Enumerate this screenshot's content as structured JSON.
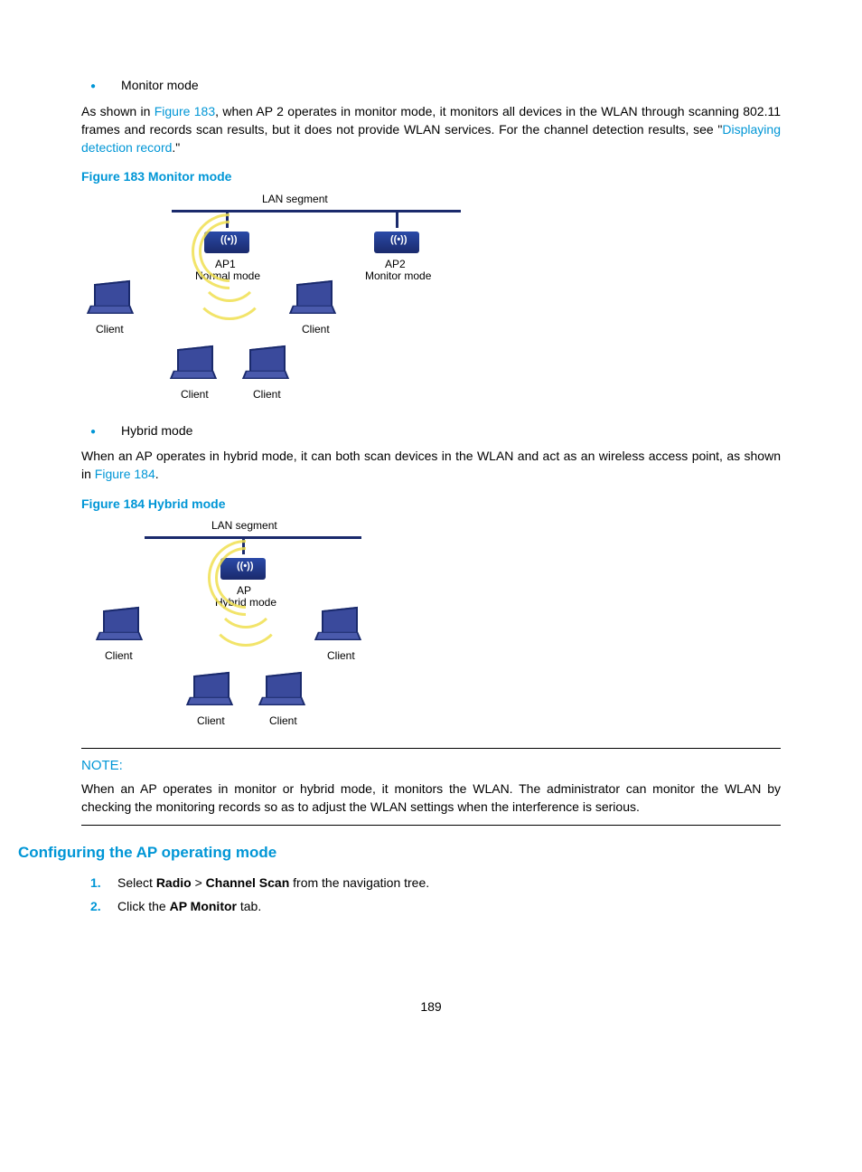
{
  "bullets": {
    "monitor": "Monitor mode",
    "hybrid": "Hybrid mode"
  },
  "para1_pre": "As shown in ",
  "para1_link": "Figure 183",
  "para1_post": ", when AP 2 operates in monitor mode, it monitors all devices in the WLAN through scanning 802.11 frames and records scan results, but it does not provide WLAN services. For the channel detection results, see \"",
  "para1_link2": "Displaying detection record",
  "para1_end": ".\"",
  "fig183_caption": "Figure 183 Monitor mode",
  "fig183": {
    "lan": "LAN segment",
    "ap1": "AP1",
    "ap1_mode": "Normal mode",
    "ap2": "AP2",
    "ap2_mode": "Monitor mode",
    "client": "Client"
  },
  "para2_pre": "When an AP operates in hybrid mode, it can both scan devices in the WLAN and act as an wireless access point, as shown in ",
  "para2_link": "Figure 184",
  "para2_end": ".",
  "fig184_caption": "Figure 184 Hybrid mode",
  "fig184": {
    "lan": "LAN segment",
    "ap": "AP",
    "ap_mode": "Hybrid mode",
    "client": "Client"
  },
  "note_label": "NOTE:",
  "note_body": "When an AP operates in monitor or hybrid mode, it monitors the WLAN. The administrator can monitor the WLAN by checking the monitoring records so as to adjust the WLAN settings when the interference is serious.",
  "heading": "Configuring the AP operating mode",
  "steps": {
    "s1": {
      "num": "1.",
      "pre": "Select ",
      "b1": "Radio",
      "mid": " > ",
      "b2": "Channel Scan",
      "post": " from the navigation tree."
    },
    "s2": {
      "num": "2.",
      "pre": "Click the ",
      "b1": "AP Monitor",
      "post": " tab."
    }
  },
  "pagenum": "189"
}
